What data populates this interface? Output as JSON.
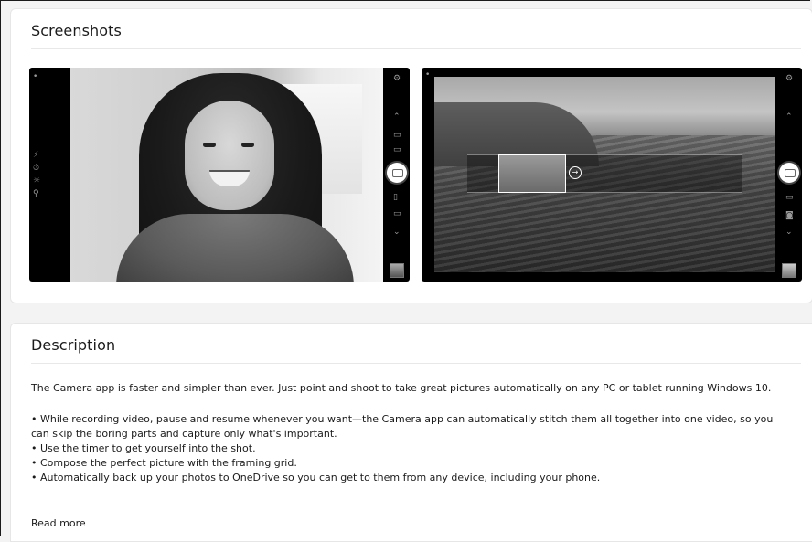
{
  "screenshots_section": {
    "title": "Screenshots"
  },
  "description_section": {
    "title": "Description",
    "intro": "The Camera app is faster and simpler than ever. Just point and shoot to take great pictures automatically on any PC or tablet running Windows 10.",
    "bullets": [
      "• While recording video, pause and resume whenever you want—the Camera app can automatically stitch them all together into one video, so you can skip the boring parts and capture only what's important.",
      "• Use the timer to get yourself into the shot.",
      "• Compose the perfect picture with the framing grid.",
      "• Automatically back up your photos to OneDrive so you can get to them from any device, including your phone."
    ],
    "read_more": "Read more"
  },
  "icons": {
    "settings": "gear-icon",
    "camera_mode": "camera-icon",
    "video_mode": "video-icon",
    "panorama_mode": "panorama-icon",
    "document_mode": "document-icon",
    "chevron_up": "chevron-up-icon",
    "chevron_down": "chevron-down-icon",
    "arrow": "arrow-right-icon"
  },
  "colors": {
    "page_background": "#f3f3f3",
    "card_background": "#ffffff",
    "text": "#1b1b1b",
    "divider": "#e8e8e8"
  }
}
